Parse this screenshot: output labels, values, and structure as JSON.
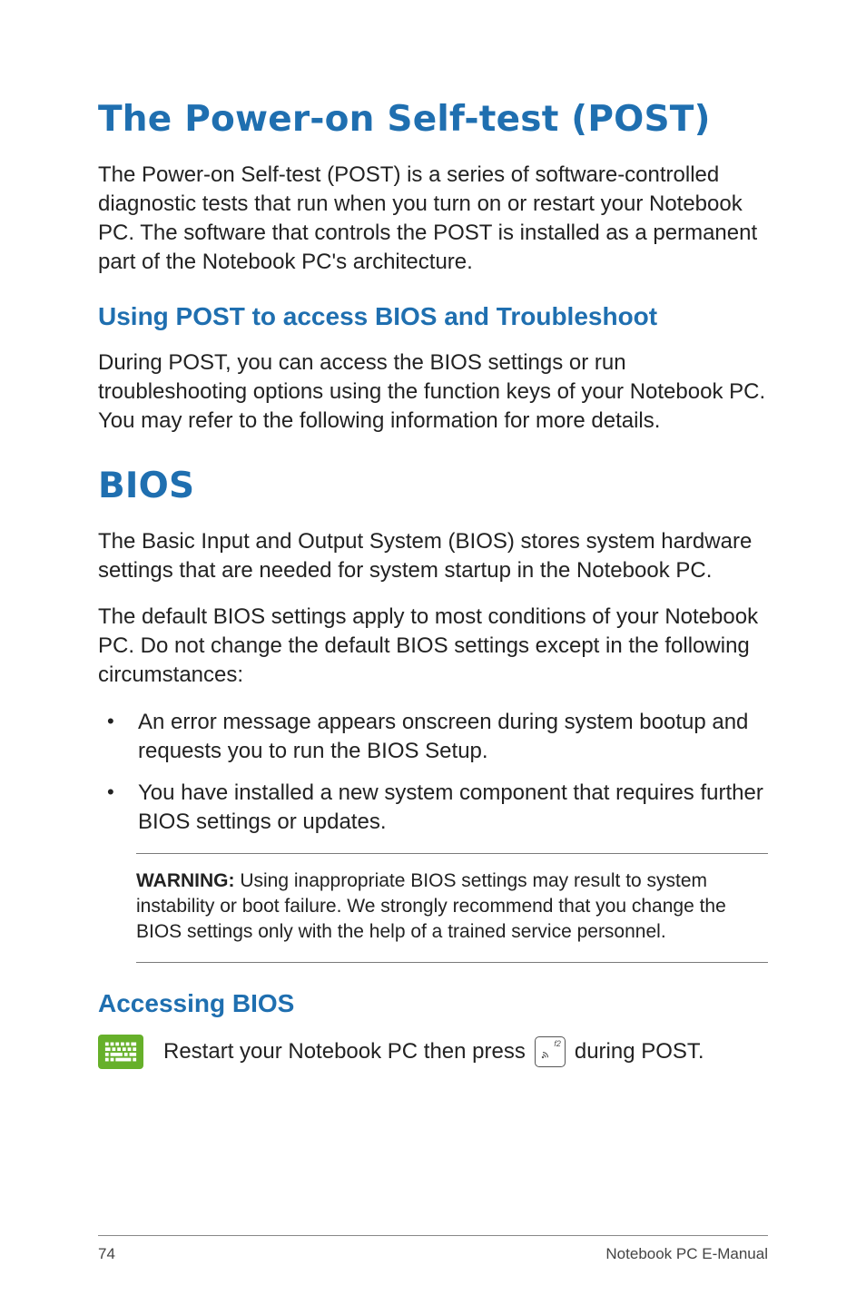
{
  "page": {
    "title1": "The Power-on Self-test (POST)",
    "para1": "The Power-on Self-test (POST)  is a series of software-controlled diagnostic tests that run when you turn on or restart your Notebook PC. The software that controls the POST is installed as a permanent part of the Notebook PC's architecture.",
    "heading2": "Using POST to access BIOS and Troubleshoot",
    "para2": "During POST, you can access the BIOS settings or run troubleshooting options using the function keys of your Notebook PC. You may refer to the following information for more details.",
    "title2": "BIOS",
    "para3": "The Basic Input and Output System (BIOS) stores system hardware settings that are needed for system startup in the Notebook PC.",
    "para4": "The default BIOS settings apply to most conditions of your Notebook PC. Do not change the default BIOS settings except in the following circumstances:",
    "bullets": [
      "An error message appears onscreen during system bootup and requests you to run the BIOS Setup.",
      "You have installed a new system component that requires further BIOS settings or updates."
    ],
    "warning_label": "WARNING:",
    "warning_text": " Using inappropriate BIOS settings may result to system instability or boot failure. We strongly recommend that you change the BIOS settings only with the help of a trained service personnel.",
    "heading3": "Accessing BIOS",
    "accessing_prefix": "Restart your Notebook PC then press ",
    "accessing_suffix": " during POST.",
    "key_fn_label": "f2",
    "footer_page": "74",
    "footer_label": "Notebook PC E-Manual"
  }
}
